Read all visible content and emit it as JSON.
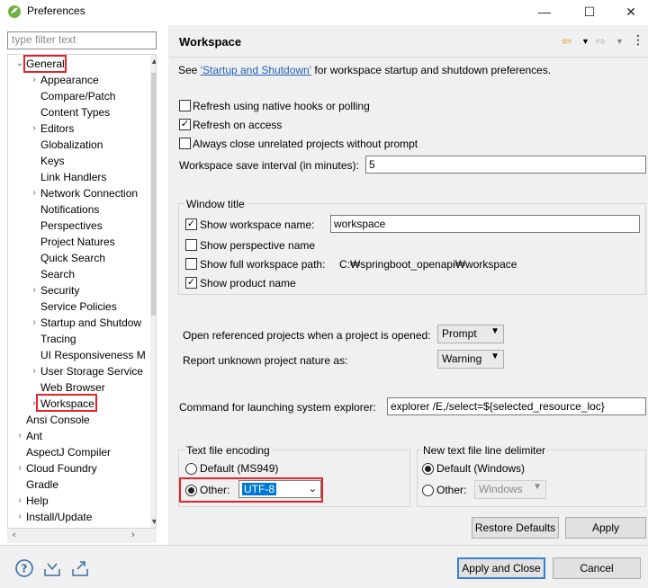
{
  "window": {
    "title": "Preferences",
    "minimize": "—",
    "maximize": "☐",
    "close": "✕"
  },
  "filter": {
    "placeholder": "type filter text"
  },
  "tree": {
    "general": "General",
    "children": [
      "Appearance",
      "Compare/Patch",
      "Content Types",
      "Editors",
      "Globalization",
      "Keys",
      "Link Handlers",
      "Network Connection",
      "Notifications",
      "Perspectives",
      "Project Natures",
      "Quick Search",
      "Search",
      "Security",
      "Service Policies",
      "Startup and Shutdow",
      "Tracing",
      "UI Responsiveness M",
      "User Storage Service",
      "Web Browser",
      "Workspace"
    ],
    "expandable_children": [
      "Appearance",
      "Editors",
      "Network Connection",
      "Security",
      "Startup and Shutdow",
      "User Storage Service",
      "Workspace"
    ],
    "top_level": [
      "Ansi Console",
      "Ant",
      "AspectJ Compiler",
      "Cloud Foundry",
      "Gradle",
      "Help",
      "Install/Update"
    ],
    "expandable_top": [
      "Ant",
      "Cloud Foundry",
      "Help",
      "Install/Update"
    ]
  },
  "page": {
    "title": "Workspace",
    "see_prefix": "See ",
    "see_link": "'Startup and Shutdown'",
    "see_suffix": " for workspace startup and shutdown preferences.",
    "refresh_native": "Refresh using native hooks or polling",
    "refresh_access": "Refresh on access",
    "close_unrelated": "Always close unrelated projects without prompt",
    "save_interval_label": "Workspace save interval (in minutes):",
    "save_interval_value": "5",
    "window_title_group": "Window title",
    "show_ws_name": "Show workspace name:",
    "ws_name_value": "workspace",
    "show_perspective": "Show perspective name",
    "show_full_path": "Show full workspace path:",
    "full_path_value": "C:₩springboot_openapi₩workspace",
    "show_product": "Show product name",
    "open_ref_label": "Open referenced projects when a project is opened:",
    "open_ref_value": "Prompt",
    "report_unknown_label": "Report unknown project nature as:",
    "report_unknown_value": "Warning",
    "command_label": "Command for launching system explorer:",
    "command_value": "explorer /E,/select=${selected_resource_loc}",
    "encoding_group": "Text file encoding",
    "enc_default": "Default (MS949)",
    "enc_other": "Other:",
    "enc_other_value": "UTF-8",
    "delim_group": "New text file line delimiter",
    "delim_default": "Default (Windows)",
    "delim_other": "Other:",
    "delim_other_value": "Windows",
    "restore_defaults": "Restore Defaults",
    "apply": "Apply"
  },
  "footer": {
    "apply_close": "Apply and Close",
    "cancel": "Cancel"
  }
}
